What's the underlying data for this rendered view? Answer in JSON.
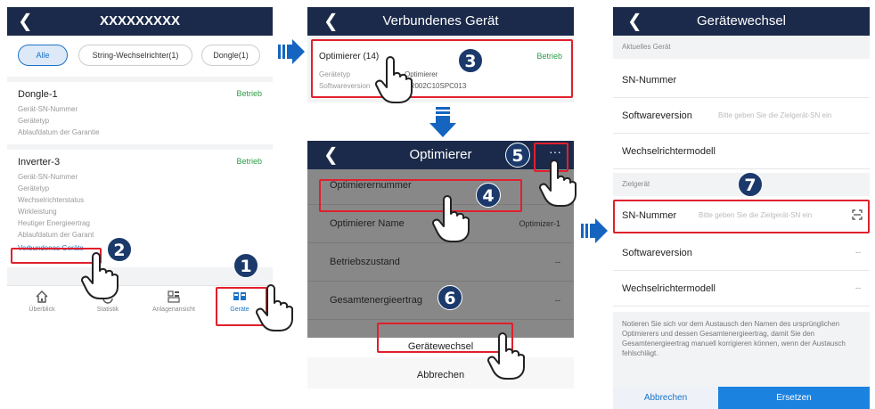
{
  "panel1": {
    "title": "XXXXXXXXX",
    "filters": [
      "Alle",
      "String-Wechselrichter(1)",
      "Dongle(1)"
    ],
    "devices": [
      {
        "name": "Dongle-1",
        "status": "Betrieb",
        "fields": [
          "Gerät-SN-Nummer",
          "Gerätetyp",
          "Ablaufdatum der Garantie"
        ]
      },
      {
        "name": "Inverter-3",
        "status": "Betrieb",
        "fields": [
          "Gerät-SN-Nummer",
          "Gerätetyp",
          "Wechselrichterstatus",
          "Wirkleistung",
          "Heutiger Energieertrag",
          "Ablaufdatum der Garant"
        ]
      }
    ],
    "connected_link": "Verbundenes Geräte",
    "tabs": [
      {
        "label": "Überblick",
        "icon": "home-icon"
      },
      {
        "label": "Statistik",
        "icon": "statistics-icon"
      },
      {
        "label": "Anlagenansicht",
        "icon": "plant-view-icon"
      },
      {
        "label": "Geräte",
        "icon": "devices-icon"
      }
    ]
  },
  "panel2_top": {
    "title": "Verbundenes Gerät",
    "device_title": "Optimierer (14)",
    "status": "Betrieb",
    "type_label": "Gerätetyp",
    "type_value": "Optimierer",
    "software_label": "Softwareversion",
    "software_value": "V100R002C10SPC013"
  },
  "panel2_bottom": {
    "title": "Optimierer",
    "more": "···",
    "rows": [
      {
        "label": "Optimierernummer",
        "value": ""
      },
      {
        "label": "Optimierer Name",
        "value": "Optimizer-1"
      },
      {
        "label": "Betriebszustand",
        "value": "--"
      },
      {
        "label": "Gesamtenergieertrag",
        "value": "--"
      }
    ],
    "sheet_action": "Gerätewechsel",
    "sheet_cancel": "Abbrechen"
  },
  "panel3": {
    "title": "Gerätewechsel",
    "current_section": "Aktuelles Gerät",
    "current_rows": [
      {
        "label": "SN-Nummer",
        "placeholder": "",
        "value": ""
      },
      {
        "label": "Softwareversion",
        "placeholder": "Bitte geben Sie die Zielgerät-SN ein",
        "value": ""
      },
      {
        "label": "Wechselrichtermodell",
        "placeholder": "",
        "value": ""
      }
    ],
    "target_section": "Zielgerät",
    "target_rows": [
      {
        "label": "SN-Nummer",
        "placeholder": "Bitte geben Sie die Zielgerät-SN ein",
        "value": ""
      },
      {
        "label": "Softwareversion",
        "placeholder": "",
        "value": "--"
      },
      {
        "label": "Wechselrichtermodell",
        "placeholder": "",
        "value": "--"
      }
    ],
    "note": "Notieren Sie sich vor dem Austausch den Namen des ursprünglichen Optimierers und dessen Gesamtenergieertrag, damit Sie den Gesamtenergieertrag manuell korrigieren können, wenn der Austausch fehlschlägt.",
    "cancel": "Abbrechen",
    "confirm": "Ersetzen"
  },
  "steps": [
    "1",
    "2",
    "3",
    "4",
    "5",
    "6",
    "7"
  ],
  "colors": {
    "header": "#1b2a4a",
    "accent": "#1a73c8",
    "status_ok": "#2e9b47",
    "highlight": "#e0202c",
    "step_badge": "#1b3a6b",
    "arrow": "#1565c0"
  }
}
